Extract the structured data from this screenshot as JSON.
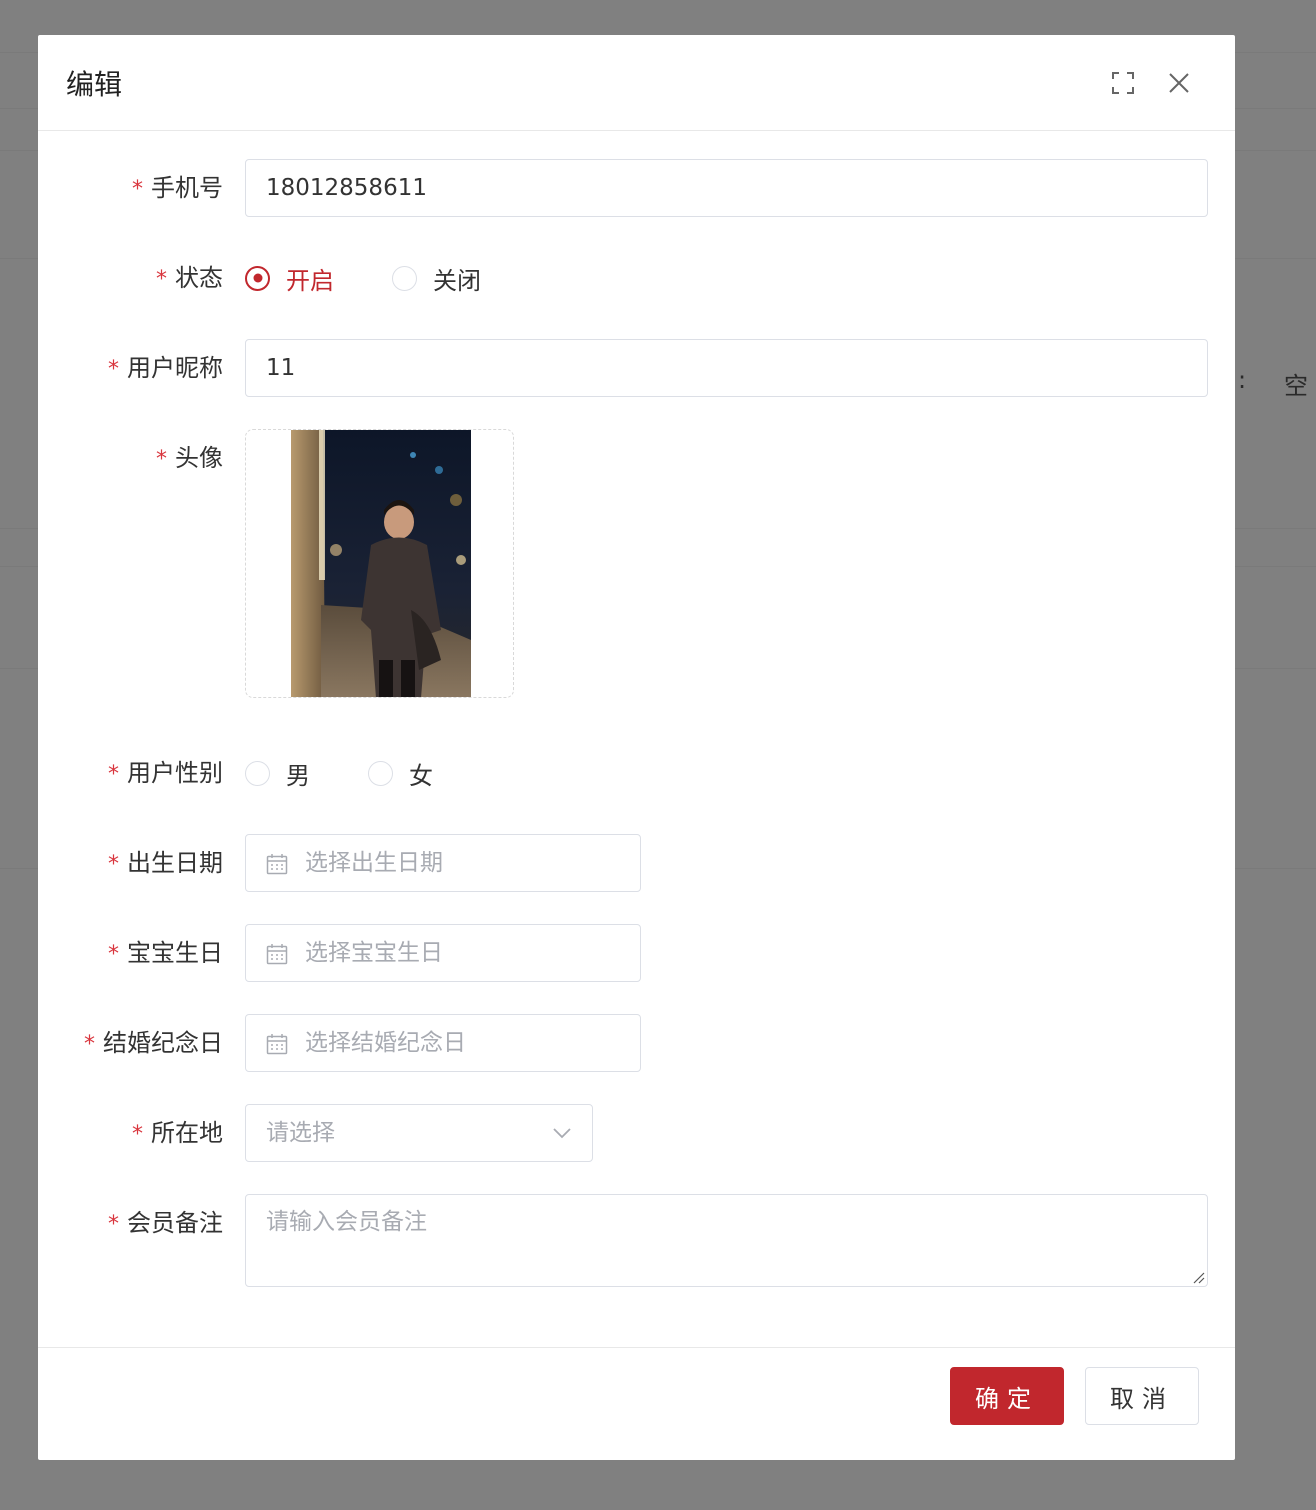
{
  "background": {
    "right_text_colon": ":",
    "right_text_char": "空"
  },
  "modal": {
    "title": "编辑",
    "icons": {
      "fullscreen": "fullscreen-icon",
      "close": "close-icon"
    }
  },
  "form": {
    "required_mark": "*",
    "phone": {
      "label": "手机号",
      "value": "18012858611"
    },
    "status": {
      "label": "状态",
      "options": [
        {
          "label": "开启",
          "checked": true
        },
        {
          "label": "关闭",
          "checked": false
        }
      ]
    },
    "nickname": {
      "label": "用户昵称",
      "value": "11"
    },
    "avatar": {
      "label": "头像"
    },
    "gender": {
      "label": "用户性别",
      "options": [
        {
          "label": "男",
          "checked": false
        },
        {
          "label": "女",
          "checked": false
        }
      ]
    },
    "birthday": {
      "label": "出生日期",
      "placeholder": "选择出生日期"
    },
    "baby_birthday": {
      "label": "宝宝生日",
      "placeholder": "选择宝宝生日"
    },
    "anniversary": {
      "label": "结婚纪念日",
      "placeholder": "选择结婚纪念日"
    },
    "location": {
      "label": "所在地",
      "placeholder": "请选择"
    },
    "remark": {
      "label": "会员备注",
      "placeholder": "请输入会员备注"
    }
  },
  "footer": {
    "confirm_label": "确定",
    "cancel_label": "取消"
  },
  "colors": {
    "primary": "#c1272d",
    "overlay": "#808080",
    "required": "#d9363e",
    "placeholder": "#a8abb2"
  }
}
